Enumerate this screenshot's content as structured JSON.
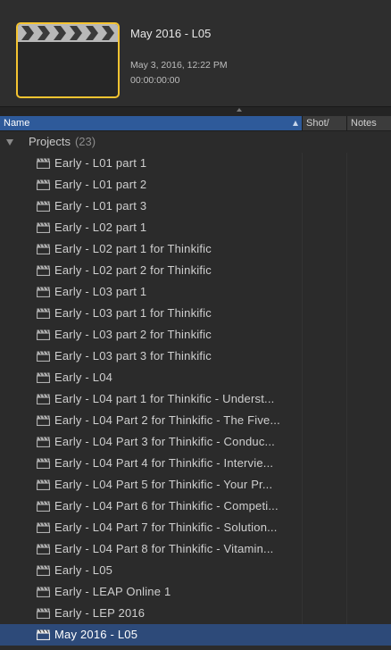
{
  "inspector": {
    "title": "May 2016 - L05",
    "date": "May 3, 2016, 12:22 PM",
    "timecode": "00:00:00:00",
    "thumbnail_icon": "clapperboard-icon",
    "accent": "#f5c431"
  },
  "columns": {
    "name": "Name",
    "shot": "Shot/",
    "notes": "Notes"
  },
  "group": {
    "name": "Projects",
    "count": "(23)"
  },
  "items": [
    {
      "label": "Early - L01 part 1"
    },
    {
      "label": "Early - L01 part 2"
    },
    {
      "label": "Early - L01 part 3"
    },
    {
      "label": "Early - L02 part 1"
    },
    {
      "label": "Early - L02 part 1 for Thinkific"
    },
    {
      "label": "Early - L02 part 2 for Thinkific"
    },
    {
      "label": "Early - L03 part 1"
    },
    {
      "label": "Early - L03 part 1 for Thinkific"
    },
    {
      "label": "Early - L03 part 2 for Thinkific"
    },
    {
      "label": "Early - L03 part 3 for Thinkific"
    },
    {
      "label": "Early - L04"
    },
    {
      "label": "Early - L04 part 1 for Thinkific - Underst..."
    },
    {
      "label": "Early - L04 Part 2 for Thinkific - The Five..."
    },
    {
      "label": "Early - L04 Part 3 for Thinkific - Conduc..."
    },
    {
      "label": "Early - L04 Part 4 for Thinkific - Intervie..."
    },
    {
      "label": "Early - L04 Part 5 for Thinkific - Your Pr..."
    },
    {
      "label": "Early - L04 Part 6 for Thinkific - Competi..."
    },
    {
      "label": "Early - L04 Part 7 for Thinkific - Solution..."
    },
    {
      "label": "Early - L04 Part 8 for Thinkific - Vitamin..."
    },
    {
      "label": "Early - L05"
    },
    {
      "label": "Early - LEAP Online 1"
    },
    {
      "label": "Early - LEP 2016"
    },
    {
      "label": "May 2016 - L05",
      "selected": true
    }
  ],
  "colors": {
    "selection": "#2d4a79",
    "header_selected": "#2e5a9a"
  }
}
